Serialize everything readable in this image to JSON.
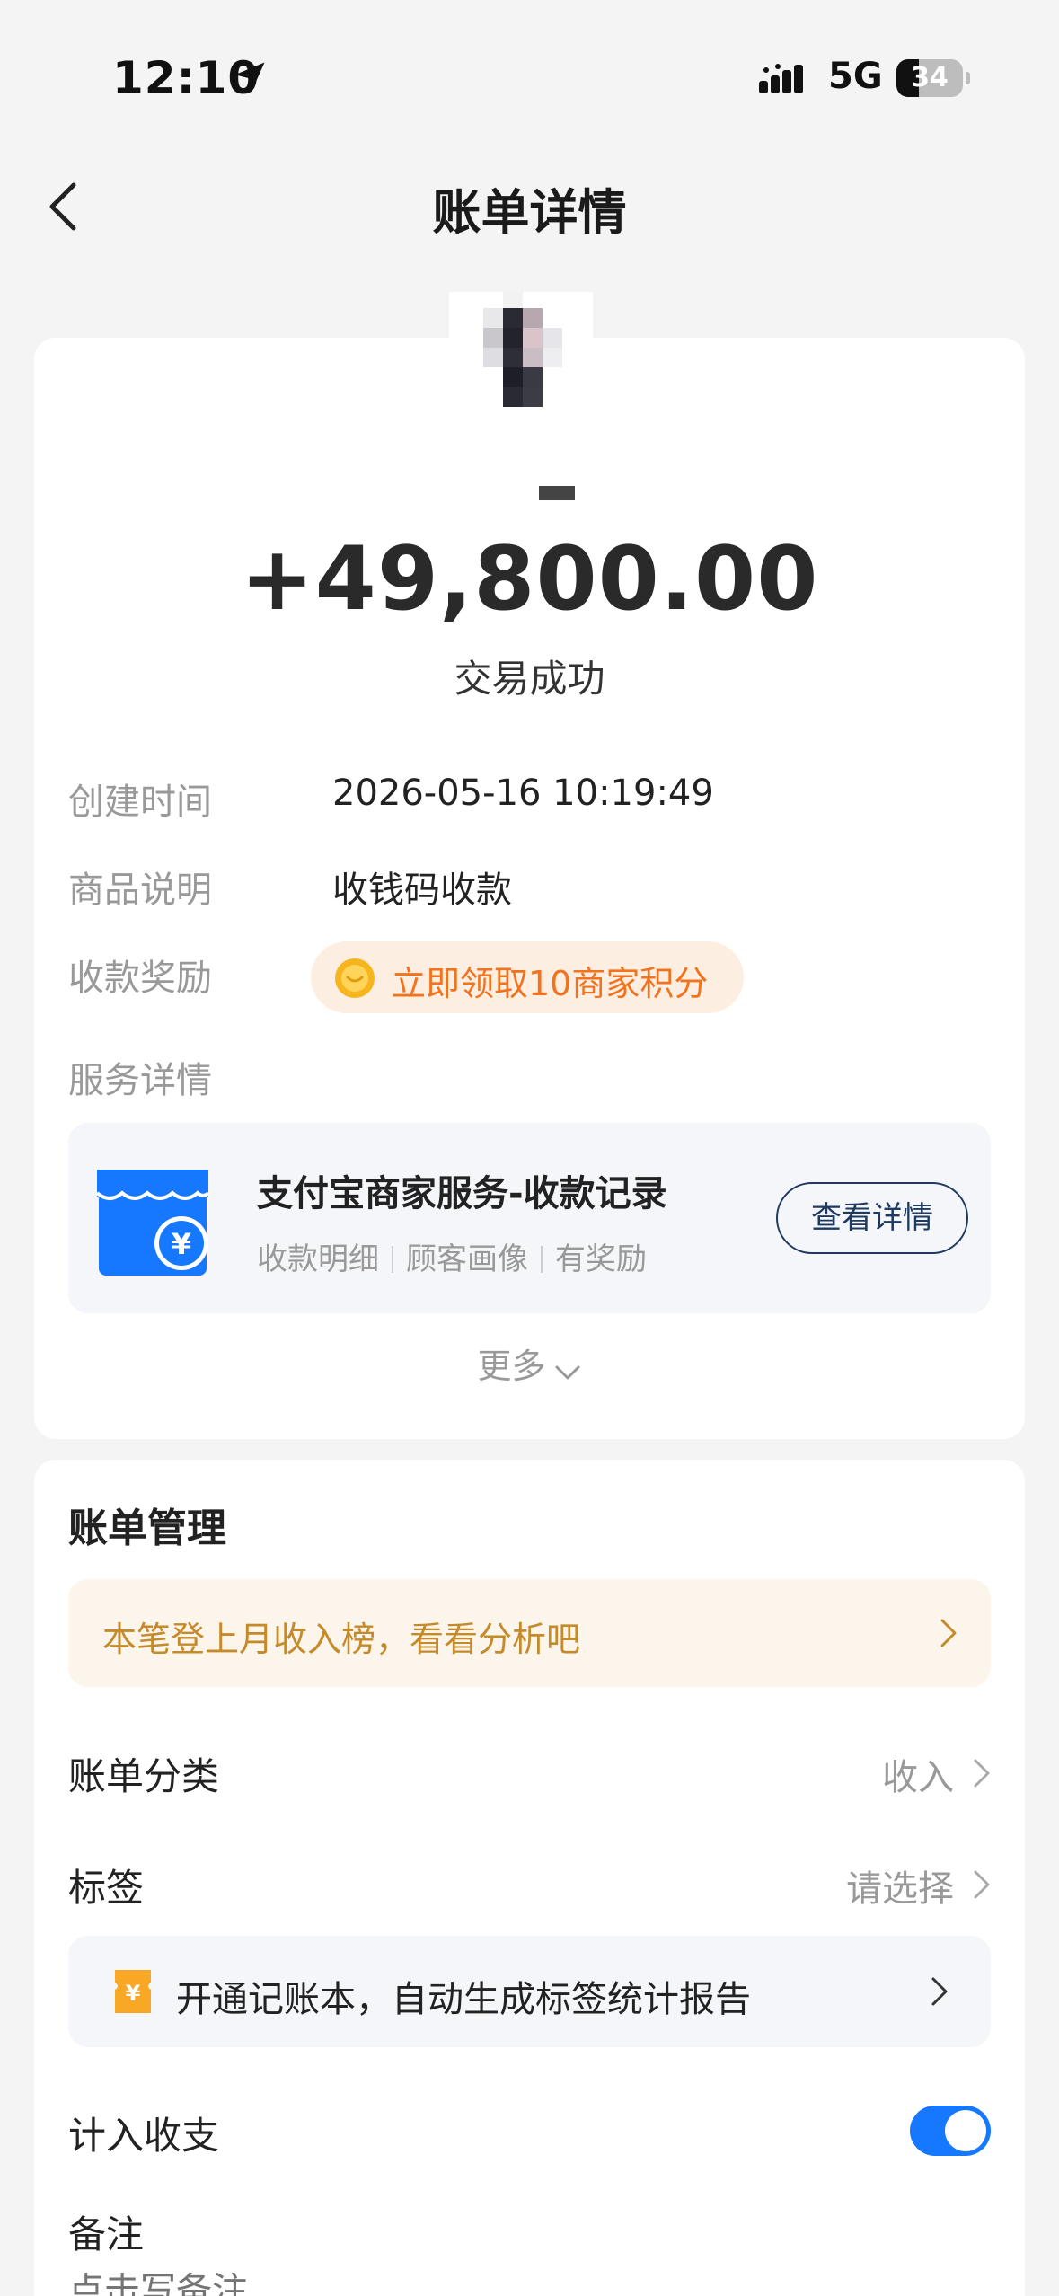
{
  "status_bar": {
    "time": "12:10",
    "network": "5G",
    "battery_level": "34",
    "battery_percent": 34
  },
  "header": {
    "title": "账单详情",
    "back_icon": "chevron-left-icon"
  },
  "transaction": {
    "amount": "+49,800.00",
    "status": "交易成功",
    "rows": [
      {
        "label": "创建时间",
        "value": "2026-05-16 10:19:49"
      },
      {
        "label": "商品说明",
        "value": "收钱码收款"
      }
    ],
    "reward_label": "收款奖励",
    "reward_text": "立即领取10商家积分",
    "service_label": "服务详情",
    "service": {
      "title": "支付宝商家服务-收款记录",
      "subtitle_parts": [
        "收款明细",
        "顾客画像",
        "有奖励"
      ],
      "button_label": "查看详情"
    },
    "more_label": "更多"
  },
  "bill_management": {
    "title": "账单管理",
    "rank_banner": "本笔登上月收入榜，看看分析吧",
    "category_label": "账单分类",
    "category_value": "收入",
    "tag_label": "标签",
    "tag_value": "请选择",
    "bookkeeping_banner": "开通记账本，自动生成标签统计报告",
    "include_label": "计入收支",
    "include_enabled": true,
    "note_label": "备注",
    "note_placeholder": "点击写备注"
  },
  "colors": {
    "accent": "#1677ff",
    "reward_orange": "#f0731f",
    "rank_gold": "#c58a2a",
    "button_navy": "#1e3a60"
  }
}
